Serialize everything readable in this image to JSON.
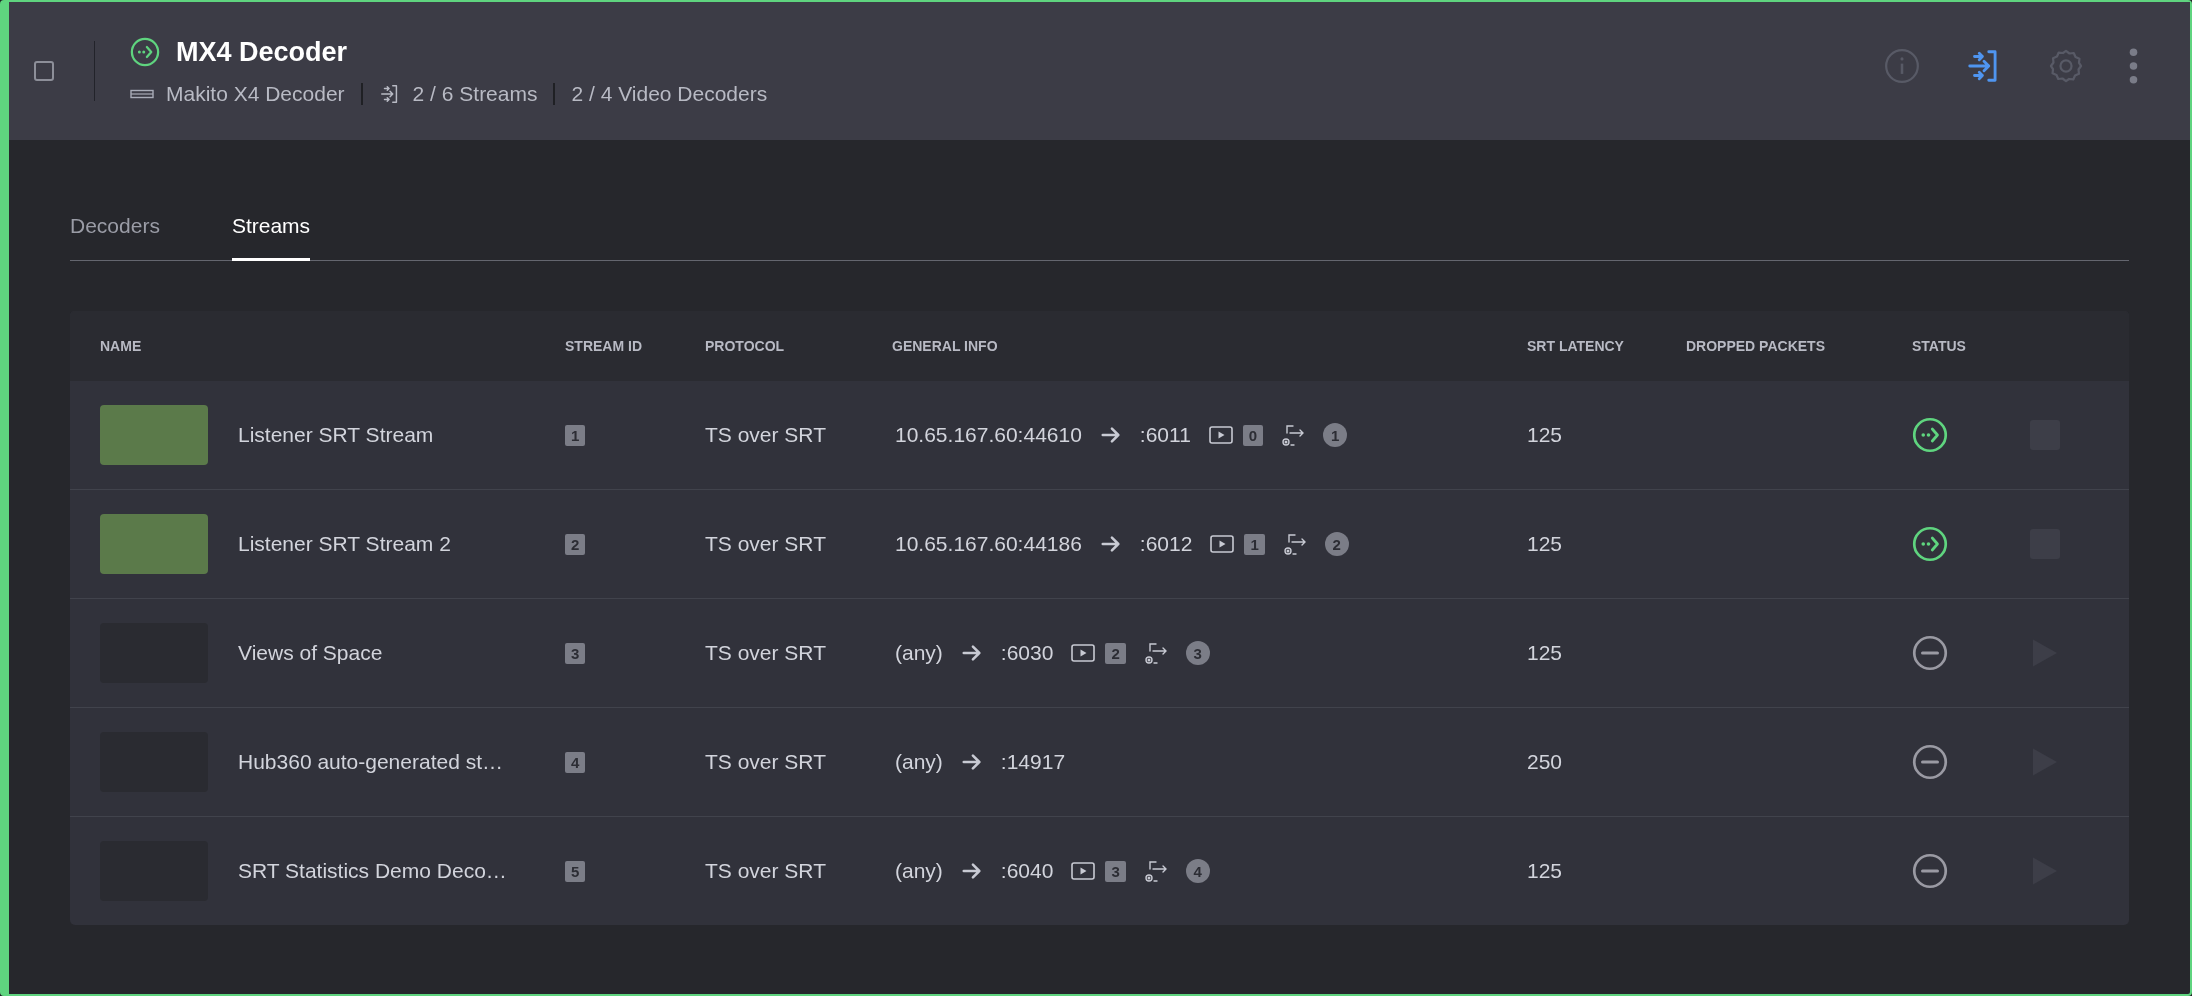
{
  "device": {
    "checked": false,
    "streaming": true,
    "title": "MX4 Decoder",
    "model": "Makito X4 Decoder",
    "streams": "2 / 6 Streams",
    "decoders": "2 / 4 Video Decoders"
  },
  "toolbar": [
    {
      "kind": "info",
      "highlighted": false
    },
    {
      "kind": "inputs",
      "highlighted": true
    },
    {
      "kind": "settings",
      "highlighted": false
    },
    {
      "kind": "more",
      "highlighted": false
    }
  ],
  "tabs": [
    {
      "label": "Decoders",
      "selected": false
    },
    {
      "label": "Streams",
      "selected": true
    }
  ],
  "table": {
    "columns": [
      "NAME",
      "STREAM ID",
      "PROTOCOL",
      "GENERAL INFO",
      "SRT LATENCY",
      "DROPPED PACKETS",
      "STATUS"
    ],
    "rows": [
      {
        "has_preview": true,
        "name": "Listener SRT Stream",
        "stream_id": "1",
        "protocol": "TS over SRT",
        "source": "10.65.167.60:44610",
        "destination": ":6011",
        "video_decoder": "0",
        "output": "1",
        "latency": "125",
        "streaming": true
      },
      {
        "has_preview": true,
        "name": "Listener SRT Stream 2",
        "stream_id": "2",
        "protocol": "TS over SRT",
        "source": "10.65.167.60:44186",
        "destination": ":6012",
        "video_decoder": "1",
        "output": "2",
        "latency": "125",
        "streaming": true
      },
      {
        "has_preview": false,
        "name": "Views of Space",
        "stream_id": "3",
        "protocol": "TS over SRT",
        "source": "(any)",
        "destination": ":6030",
        "video_decoder": "2",
        "output": "3",
        "latency": "125",
        "streaming": false
      },
      {
        "has_preview": false,
        "name": "Hub360 auto-generated st…",
        "stream_id": "4",
        "protocol": "TS over SRT",
        "source": "(any)",
        "destination": ":14917",
        "latency": "250",
        "streaming": false
      },
      {
        "has_preview": false,
        "name": "SRT Statistics Demo Deco…",
        "stream_id": "5",
        "protocol": "TS over SRT",
        "source": "(any)",
        "destination": ":6040",
        "video_decoder": "3",
        "output": "4",
        "latency": "125",
        "streaming": false
      }
    ]
  }
}
